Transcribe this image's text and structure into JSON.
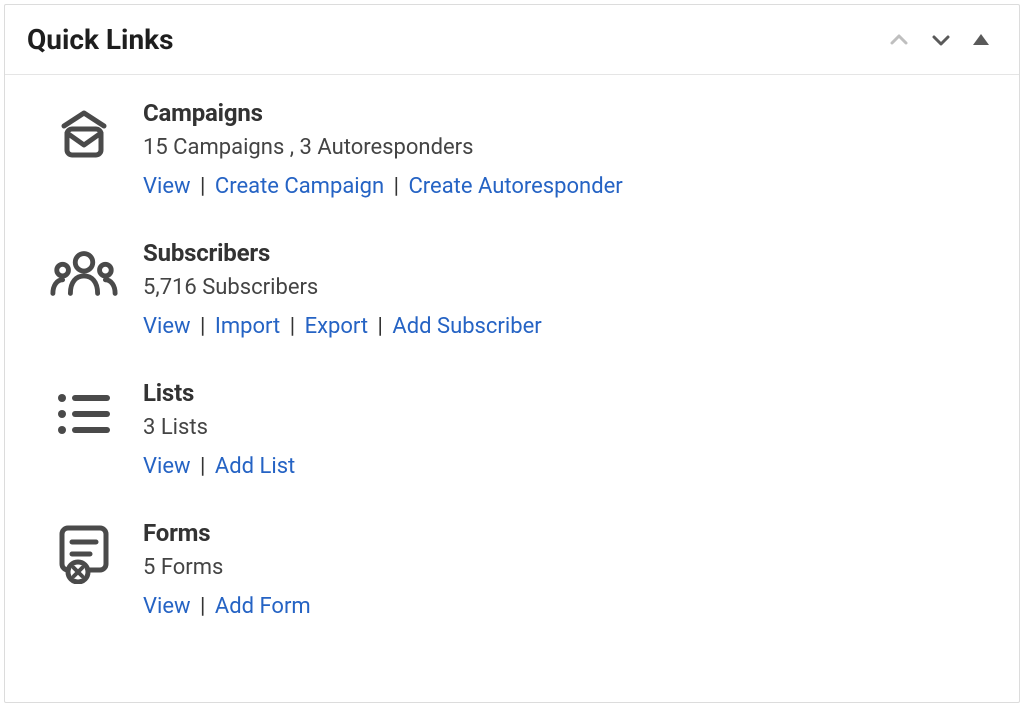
{
  "header": {
    "title": "Quick Links"
  },
  "campaigns": {
    "title": "Campaigns",
    "summary": "15 Campaigns , 3 Autoresponders",
    "links": {
      "view": "View",
      "create_campaign": "Create Campaign",
      "create_autoresponder": "Create Autoresponder"
    }
  },
  "subscribers": {
    "title": "Subscribers",
    "summary": "5,716 Subscribers",
    "links": {
      "view": "View",
      "import": "Import",
      "export": "Export",
      "add": "Add Subscriber"
    }
  },
  "lists": {
    "title": "Lists",
    "summary": "3 Lists",
    "links": {
      "view": "View",
      "add": "Add List"
    }
  },
  "forms": {
    "title": "Forms",
    "summary": "5 Forms",
    "links": {
      "view": "View",
      "add": "Add Form"
    }
  }
}
